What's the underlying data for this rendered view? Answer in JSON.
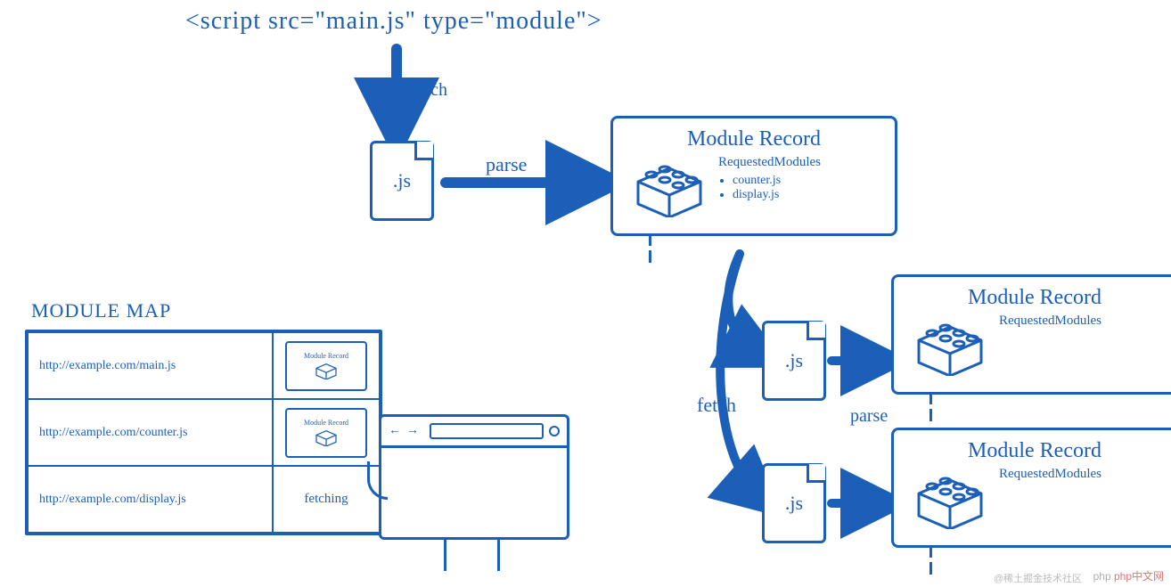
{
  "script_tag": "<script src=\"main.js\" type=\"module\">",
  "labels": {
    "fetch": "fetch",
    "parse": "parse",
    "js_ext": ".js",
    "fetching": "fetching",
    "module_map": "MODULE MAP",
    "module_record": "Module Record",
    "requested_modules": "RequestedModules"
  },
  "record1_deps": [
    "counter.js",
    "display.js"
  ],
  "module_map": {
    "rows": [
      {
        "url": "http://example.com/main.js",
        "state": "record"
      },
      {
        "url": "http://example.com/counter.js",
        "state": "record"
      },
      {
        "url": "http://example.com/display.js",
        "state": "fetching"
      }
    ]
  },
  "watermark": "php中文网",
  "watermark2": "@稀土掘金技术社区"
}
